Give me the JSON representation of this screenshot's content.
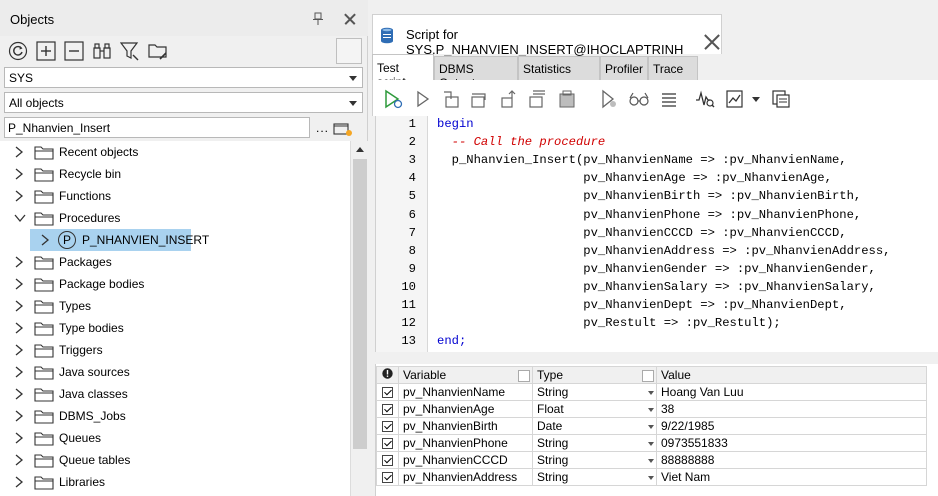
{
  "objects_panel": {
    "title": "Objects",
    "schema_value": "SYS",
    "object_filter_value": "All objects",
    "search_value": "P_Nhanvien_Insert",
    "more_label": "...",
    "tree": [
      {
        "label": "Recent objects",
        "expanded": false
      },
      {
        "label": "Recycle bin",
        "expanded": false
      },
      {
        "label": "Functions",
        "expanded": false
      },
      {
        "label": "Procedures",
        "expanded": true
      },
      {
        "label": "P_NHANVIEN_INSERT",
        "child": true,
        "selected": true,
        "icon_letter": "P"
      },
      {
        "label": "Packages",
        "expanded": false
      },
      {
        "label": "Package bodies",
        "expanded": false
      },
      {
        "label": "Types",
        "expanded": false
      },
      {
        "label": "Type bodies",
        "expanded": false
      },
      {
        "label": "Triggers",
        "expanded": false
      },
      {
        "label": "Java sources",
        "expanded": false
      },
      {
        "label": "Java classes",
        "expanded": false
      },
      {
        "label": "DBMS_Jobs",
        "expanded": false
      },
      {
        "label": "Queues",
        "expanded": false
      },
      {
        "label": "Queue tables",
        "expanded": false
      },
      {
        "label": "Libraries",
        "expanded": false
      }
    ]
  },
  "editor_window": {
    "tab_title": "Script for SYS.P_NHANVIEN_INSERT@IHOCLAPTRINH",
    "subtabs": [
      "Test script",
      "DBMS Output",
      "Statistics",
      "Profiler",
      "Trace"
    ],
    "active_subtab": "Test script",
    "code_lines": [
      {
        "n": "1",
        "parts": [
          {
            "t": "begin",
            "c": "kw"
          }
        ]
      },
      {
        "n": "2",
        "parts": [
          {
            "t": "  -- Call the procedure",
            "c": "cmt"
          }
        ]
      },
      {
        "n": "3",
        "parts": [
          {
            "t": "  p_Nhanvien_Insert(pv_NhanvienName => :pv_NhanvienName,",
            "c": ""
          }
        ]
      },
      {
        "n": "4",
        "parts": [
          {
            "t": "                    pv_NhanvienAge => :pv_NhanvienAge,",
            "c": ""
          }
        ]
      },
      {
        "n": "5",
        "parts": [
          {
            "t": "                    pv_NhanvienBirth => :pv_NhanvienBirth,",
            "c": ""
          }
        ]
      },
      {
        "n": "6",
        "parts": [
          {
            "t": "                    pv_NhanvienPhone => :pv_NhanvienPhone,",
            "c": ""
          }
        ]
      },
      {
        "n": "7",
        "parts": [
          {
            "t": "                    pv_NhanvienCCCD => :pv_NhanvienCCCD,",
            "c": ""
          }
        ]
      },
      {
        "n": "8",
        "parts": [
          {
            "t": "                    pv_NhanvienAddress => :pv_NhanvienAddress,",
            "c": ""
          }
        ]
      },
      {
        "n": "9",
        "parts": [
          {
            "t": "                    pv_NhanvienGender => :pv_NhanvienGender,",
            "c": ""
          }
        ]
      },
      {
        "n": "10",
        "parts": [
          {
            "t": "                    pv_NhanvienSalary => :pv_NhanvienSalary,",
            "c": ""
          }
        ]
      },
      {
        "n": "11",
        "parts": [
          {
            "t": "                    pv_NhanvienDept => :pv_NhanvienDept,",
            "c": ""
          }
        ]
      },
      {
        "n": "12",
        "parts": [
          {
            "t": "                    pv_Restult => :pv_Restult);",
            "c": ""
          }
        ]
      },
      {
        "n": "13",
        "parts": [
          {
            "t": "end;",
            "c": "kw"
          }
        ]
      }
    ],
    "variables": {
      "headers": {
        "variable": "Variable",
        "type": "Type",
        "value": "Value"
      },
      "rows": [
        {
          "variable": "pv_NhanvienName",
          "type": "String",
          "value": "Hoang Van Luu"
        },
        {
          "variable": "pv_NhanvienAge",
          "type": "Float",
          "value": "38"
        },
        {
          "variable": "pv_NhanvienBirth",
          "type": "Date",
          "value": "9/22/1985"
        },
        {
          "variable": "pv_NhanvienPhone",
          "type": "String",
          "value": "0973551833"
        },
        {
          "variable": "pv_NhanvienCCCD",
          "type": "String",
          "value": "88888888"
        },
        {
          "variable": "pv_NhanvienAddress",
          "type": "String",
          "value": "Viet Nam"
        }
      ]
    }
  },
  "colors": {
    "selection": "#a9d2ef",
    "keyword": "#0000d0",
    "comment": "#d00000",
    "icon_green": "#2e9a3c"
  }
}
